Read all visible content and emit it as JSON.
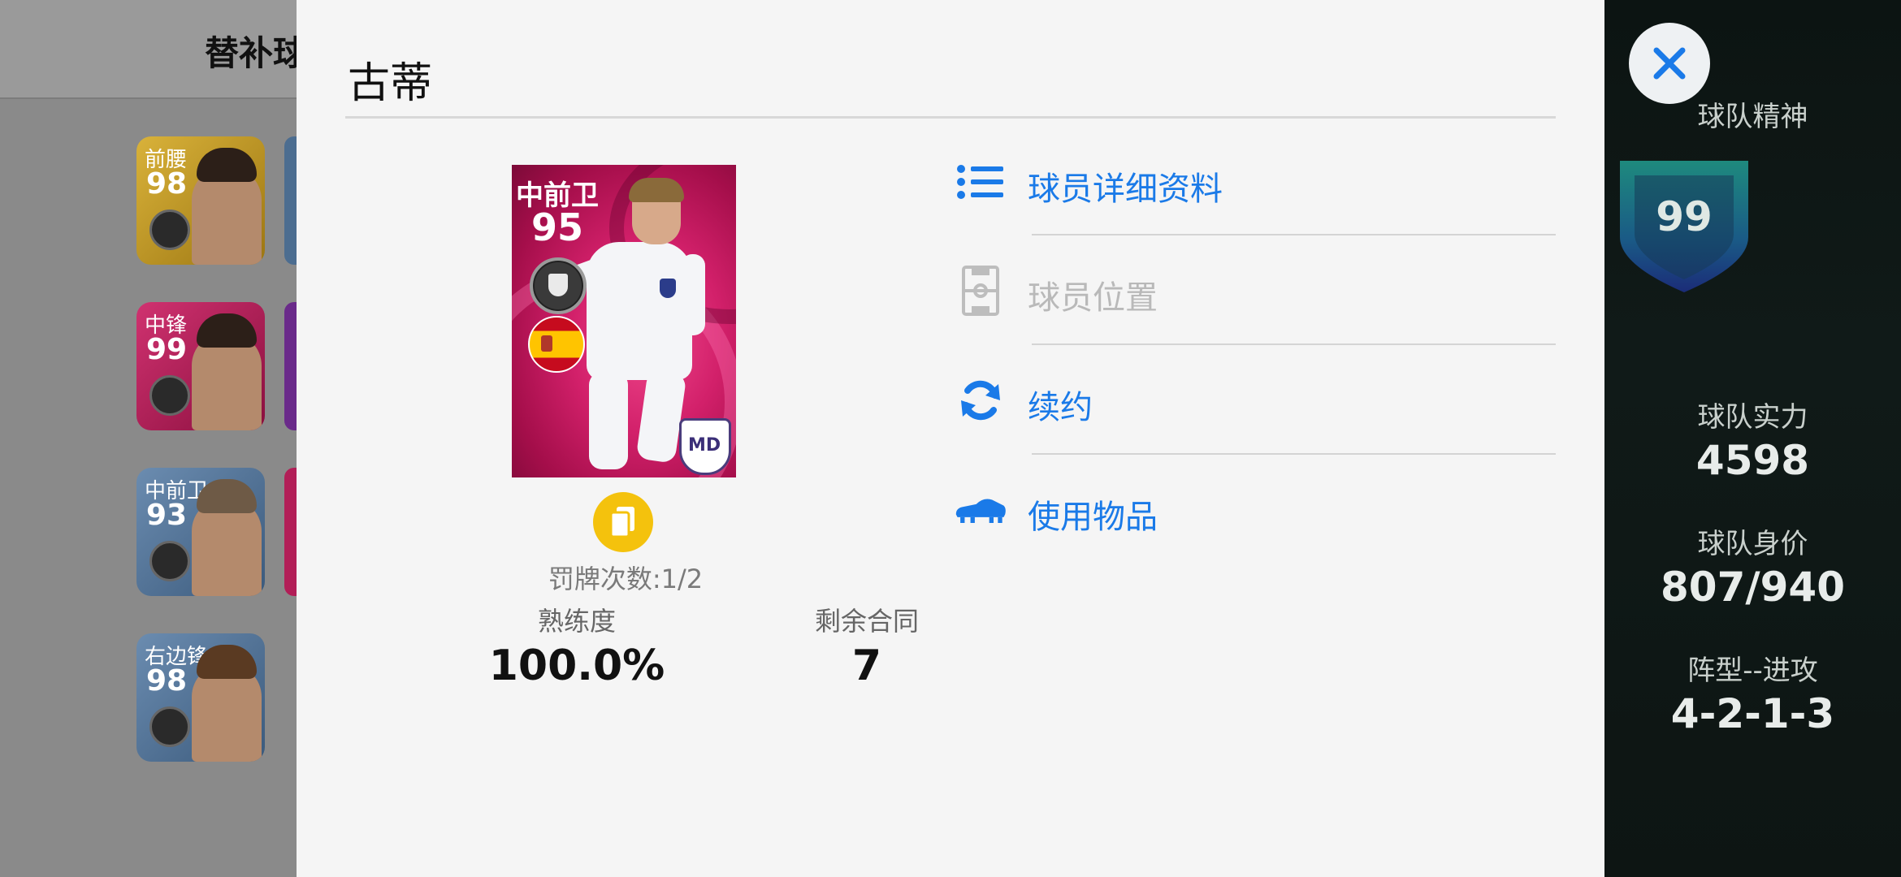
{
  "background": {
    "header_title": "替补球",
    "cards": [
      {
        "position": "前腰",
        "rating": "98",
        "color": "#c79a1d"
      },
      {
        "position": "中锋",
        "rating": "99",
        "color": "#b21e57"
      },
      {
        "position": "中前卫",
        "rating": "93",
        "color": "#4c6d90"
      },
      {
        "position": "右边锋",
        "rating": "98",
        "color": "#4c6d90"
      }
    ]
  },
  "modal": {
    "title": "古蒂",
    "card": {
      "position": "中前卫",
      "rating": "95",
      "flag": "spain-flag",
      "club_badge": "club-crest-icon"
    },
    "card_count_label": "罚牌次数:1/2",
    "stats": [
      {
        "label": "熟练度",
        "value": "100.0%"
      },
      {
        "label": "剩余合同",
        "value": "7"
      }
    ],
    "menu": [
      {
        "label": "球员详细资料",
        "icon": "list-icon",
        "enabled": true
      },
      {
        "label": "球员位置",
        "icon": "pitch-icon",
        "enabled": false
      },
      {
        "label": "续约",
        "icon": "refresh-icon",
        "enabled": true
      },
      {
        "label": "使用物品",
        "icon": "boot-icon",
        "enabled": true
      }
    ],
    "accent_color": "#1a7ae8"
  },
  "right_panel": {
    "team_spirit_label": "球队精神",
    "team_spirit_value": "99",
    "team_strength_label": "球队实力",
    "team_strength_value": "4598",
    "team_value_label": "球队身价",
    "team_value_value": "807/940",
    "formation_label": "阵型--进攻",
    "formation_value": "4-2-1-3"
  }
}
